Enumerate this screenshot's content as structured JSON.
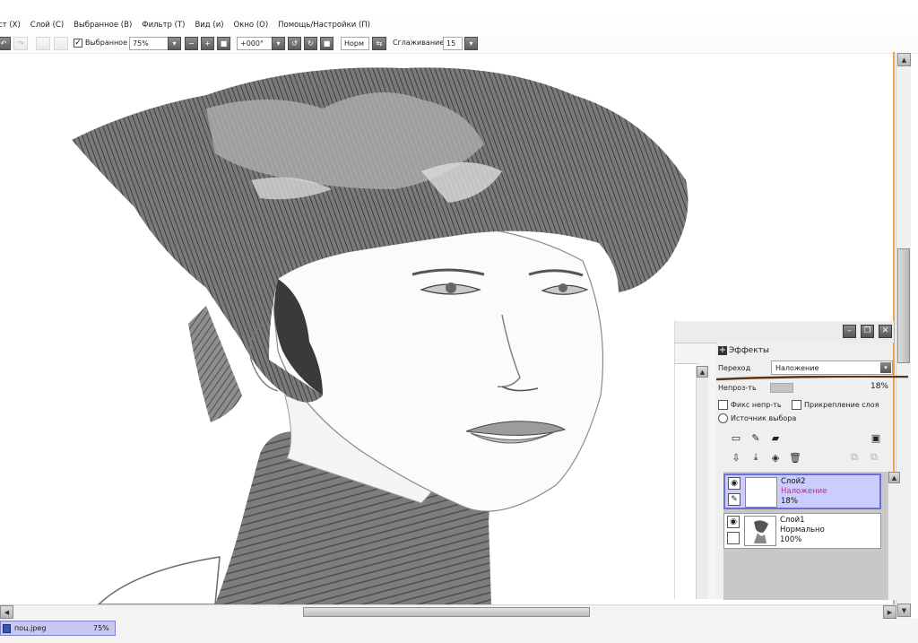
{
  "menu": [
    "ст (X)",
    "Слой (C)",
    "Выбранное (B)",
    "Фильтр (T)",
    "Вид (и)",
    "Окно (O)",
    "Помощь/Настройки (П)"
  ],
  "toolbar": {
    "selection_label": "Выбранное",
    "zoom": "75%",
    "rotation": "+000°",
    "mode": "Норм",
    "smoothing_label": "Сглаживание",
    "smoothing_value": "15"
  },
  "document": {
    "name": "поц.jpeg",
    "zoom": "75%"
  },
  "panel": {
    "effects_label": "Эффекты",
    "blend_label": "Переход",
    "blend_value": "Наложение",
    "opacity_label": "Непроз-ть",
    "opacity_value": "18%",
    "opacity_fraction": 0.18,
    "lock_opacity_label": "Фикс непр-ть",
    "clip_label": "Прикрепление слоя",
    "source_label": "Источник выбора"
  },
  "layers": [
    {
      "name": "Слой2",
      "mode": "Наложение",
      "opacity": "18%",
      "active": true
    },
    {
      "name": "Слой1",
      "mode": "Нормально",
      "opacity": "100%",
      "active": false
    }
  ],
  "colors": {
    "frame_accent": "#f0a14a",
    "active_layer": "#ccccff",
    "active_layer_border": "#6b6fd8",
    "mode_text": "#c02a7d",
    "doc_tab": "#c6c8f2"
  },
  "icons": {
    "undo": "undo-icon",
    "redo": "redo-icon",
    "new_layer": "new-layer-icon",
    "new_folder": "folder-icon",
    "delete": "trash-icon",
    "visibility": "eye-icon",
    "pen": "pen-icon"
  }
}
